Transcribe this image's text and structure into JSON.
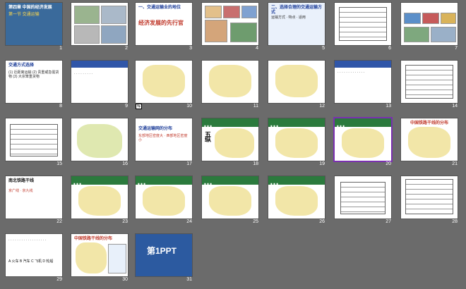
{
  "slides": [
    {
      "num": "1",
      "title": "第四章 中国的经济发展",
      "text": "第一节 交通运输"
    },
    {
      "num": "2",
      "title": "",
      "text": ""
    },
    {
      "num": "3",
      "title": "一、交通运输业的地位",
      "text": "经济发展的先行官"
    },
    {
      "num": "4",
      "title": "",
      "text": ""
    },
    {
      "num": "5",
      "title": "二、选择合理的交通运输方式",
      "text": "运输方式 · 特点 · 适用"
    },
    {
      "num": "6",
      "title": "",
      "text": ""
    },
    {
      "num": "7",
      "title": "",
      "text": ""
    },
    {
      "num": "8",
      "title": "交通方式选择",
      "text": "(1) 近距离运输 (2) 贵重或急需货物 (3) 大宗笨重货物"
    },
    {
      "num": "9",
      "title": "",
      "text": ""
    },
    {
      "num": "10",
      "title": "",
      "text": ""
    },
    {
      "num": "11",
      "title": "",
      "text": ""
    },
    {
      "num": "12",
      "title": "",
      "text": ""
    },
    {
      "num": "13",
      "title": "",
      "text": ""
    },
    {
      "num": "14",
      "title": "",
      "text": ""
    },
    {
      "num": "15",
      "title": "",
      "text": ""
    },
    {
      "num": "16",
      "title": "",
      "text": ""
    },
    {
      "num": "17",
      "title": "交通运输网的分布",
      "text": "东部地区密度大 · 西部地区密度小"
    },
    {
      "num": "18",
      "title": "五纵",
      "text": ""
    },
    {
      "num": "19",
      "title": "",
      "text": ""
    },
    {
      "num": "20",
      "title": "",
      "text": ""
    },
    {
      "num": "21",
      "title": "中国铁路干线的分布",
      "text": ""
    },
    {
      "num": "22",
      "title": "南北铁路干线",
      "text": "京广线 · 京九线"
    },
    {
      "num": "23",
      "title": "",
      "text": ""
    },
    {
      "num": "24",
      "title": "",
      "text": ""
    },
    {
      "num": "25",
      "title": "",
      "text": ""
    },
    {
      "num": "26",
      "title": "",
      "text": ""
    },
    {
      "num": "27",
      "title": "",
      "text": ""
    },
    {
      "num": "28",
      "title": "",
      "text": ""
    },
    {
      "num": "29",
      "title": "",
      "text": "A 火车 B 汽车 C 飞机 D 轮船"
    },
    {
      "num": "30",
      "title": "中国铁路干线的分布",
      "text": ""
    },
    {
      "num": "31",
      "title": "第1PPT",
      "text": ""
    }
  ]
}
